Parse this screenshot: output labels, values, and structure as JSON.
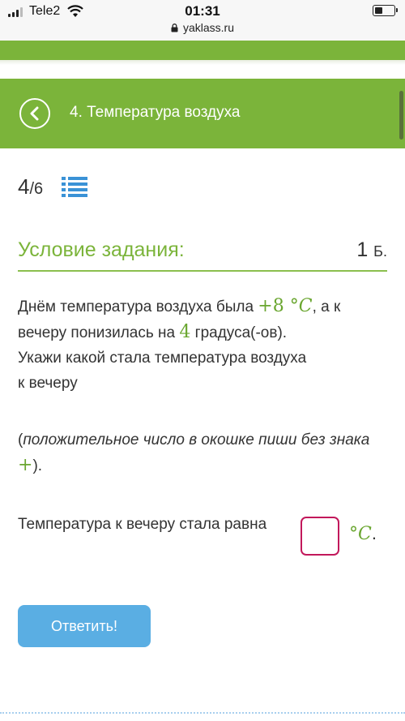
{
  "status_bar": {
    "carrier": "Tele2",
    "time": "01:31",
    "url": "yaklass.ru",
    "battery_level": 0.45,
    "signal_bars": 3
  },
  "header": {
    "title": "4. Температура воздуха",
    "back_icon": "chevron-left-icon",
    "color": "#7bb43a"
  },
  "progress": {
    "current": "4",
    "total": "/6",
    "list_icon": "list-icon"
  },
  "condition": {
    "title": "Условие задания:",
    "points_value": "1",
    "points_unit": "Б."
  },
  "task": {
    "text_1": "Днём температура воздуха была ",
    "temp_value": "+8",
    "temp_unit_degree": "°",
    "temp_unit_letter": "C",
    "text_2": ", а к вечеру понизилась на ",
    "drop_value": "4",
    "text_3": " градуса(-ов).",
    "text_4": "Укажи какой стала температура воздуха",
    "text_5": "к вечеру"
  },
  "hint": {
    "open": "(",
    "text": "положительное число в окошке пиши без знака ",
    "plus": "+",
    "close": ")."
  },
  "answer": {
    "label": "Температура к вечеру стала равна",
    "value": "",
    "unit_degree": "°",
    "unit_letter": "C",
    "period": "."
  },
  "submit": {
    "label": "Ответить!",
    "color": "#5aaee3"
  },
  "colors": {
    "accent_green": "#7bb43a",
    "number_green": "#6aa630",
    "input_border": "#c2185b"
  }
}
